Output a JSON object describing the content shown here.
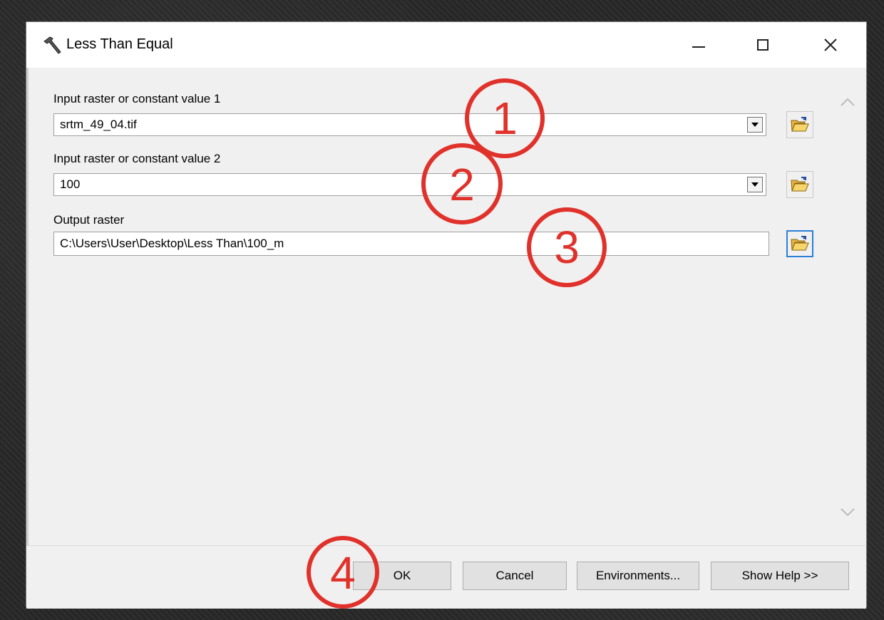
{
  "window": {
    "title": "Less Than Equal"
  },
  "fields": [
    {
      "label": "Input raster or constant value 1",
      "value": "srtm_49_04.tif"
    },
    {
      "label": "Input raster or constant value 2",
      "value": "100"
    },
    {
      "label": "Output raster",
      "value": "C:\\Users\\User\\Desktop\\Less Than\\100_m"
    }
  ],
  "buttons": {
    "ok": "OK",
    "cancel": "Cancel",
    "environments": "Environments...",
    "show_help": "Show Help >>"
  },
  "annotations": [
    "1",
    "2",
    "3",
    "4"
  ],
  "colors": {
    "annotation": "#e0312b",
    "focus": "#2b7fd8"
  },
  "icons": {
    "app": "hammer-icon",
    "browse": "folder-open-icon"
  }
}
